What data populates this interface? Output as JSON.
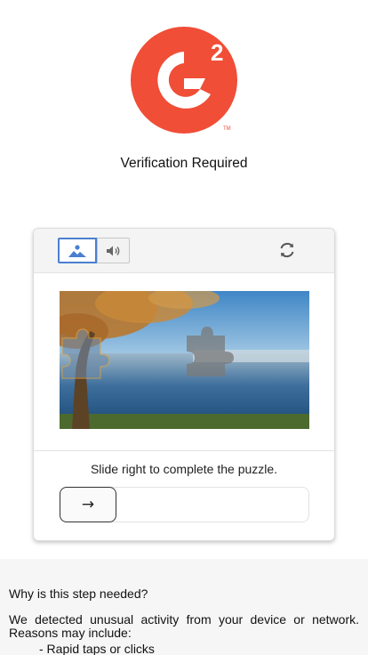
{
  "brand": {
    "logo": "G2 logo",
    "superscript": "2",
    "trademark": "TM",
    "color": "#f04e37"
  },
  "page": {
    "title": "Verification Required"
  },
  "captcha": {
    "modes": [
      {
        "icon": "image-icon",
        "selected": true
      },
      {
        "icon": "speaker-icon",
        "selected": false
      }
    ],
    "refresh_icon": "refresh-icon",
    "instruction": "Slide right to complete the puzzle.",
    "slider_icon": "arrow-right-icon",
    "slider_arrow": "→",
    "accent_color": "#4a7fd0"
  },
  "info": {
    "question": "Why is this step needed?",
    "explanation": "We detected unusual activity from your device or network. Reasons may include:",
    "reasons": [
      "- Rapid taps or clicks"
    ]
  }
}
